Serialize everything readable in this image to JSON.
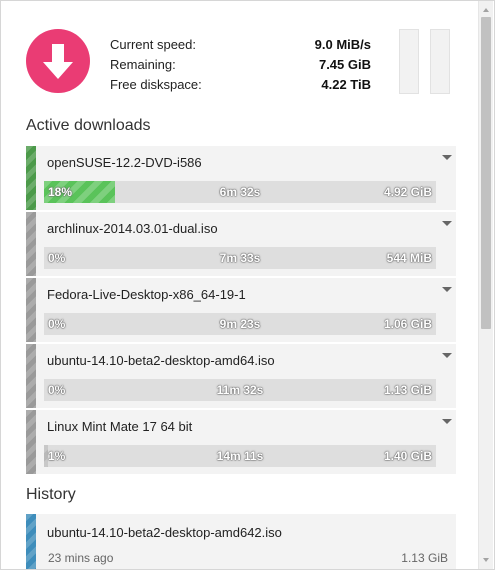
{
  "header": {
    "stats": [
      {
        "label": "Current speed:",
        "value": "9.0 MiB/s"
      },
      {
        "label": "Remaining:",
        "value": "7.45 GiB"
      },
      {
        "label": "Free diskspace:",
        "value": "4.22 TiB"
      }
    ]
  },
  "active": {
    "title": "Active downloads",
    "items": [
      {
        "name": "openSUSE-12.2-DVD-i586",
        "percent": "18%",
        "progress": 0.18,
        "eta": "6m 32s",
        "size": "4.92 GiB",
        "state": "active"
      },
      {
        "name": "archlinux-2014.03.01-dual.iso",
        "percent": "0%",
        "progress": 0.0,
        "eta": "7m 33s",
        "size": "544 MiB",
        "state": "queued"
      },
      {
        "name": "Fedora-Live-Desktop-x86_64-19-1",
        "percent": "0%",
        "progress": 0.0,
        "eta": "9m 23s",
        "size": "1.06 GiB",
        "state": "queued"
      },
      {
        "name": "ubuntu-14.10-beta2-desktop-amd64.iso",
        "percent": "0%",
        "progress": 0.0,
        "eta": "11m 32s",
        "size": "1.13 GiB",
        "state": "queued"
      },
      {
        "name": "Linux Mint Mate 17 64 bit",
        "percent": "1%",
        "progress": 0.01,
        "eta": "14m 11s",
        "size": "1.40 GiB",
        "state": "queued"
      }
    ]
  },
  "history": {
    "title": "History",
    "items": [
      {
        "name": "ubuntu-14.10-beta2-desktop-amd642.iso",
        "time": "23 mins ago",
        "size": "1.13 GiB"
      }
    ]
  },
  "icons": {
    "download": "download-arrow-icon",
    "pause": "pause-icon",
    "menu": "chevron-down-icon"
  },
  "colors": {
    "accent": "#ea3c74",
    "active_stripe": "#4c9a4a",
    "progress_fill": "#5ac35a",
    "queued_stripe": "#9a9a9a",
    "history_stripe": "#3e8dbb"
  }
}
